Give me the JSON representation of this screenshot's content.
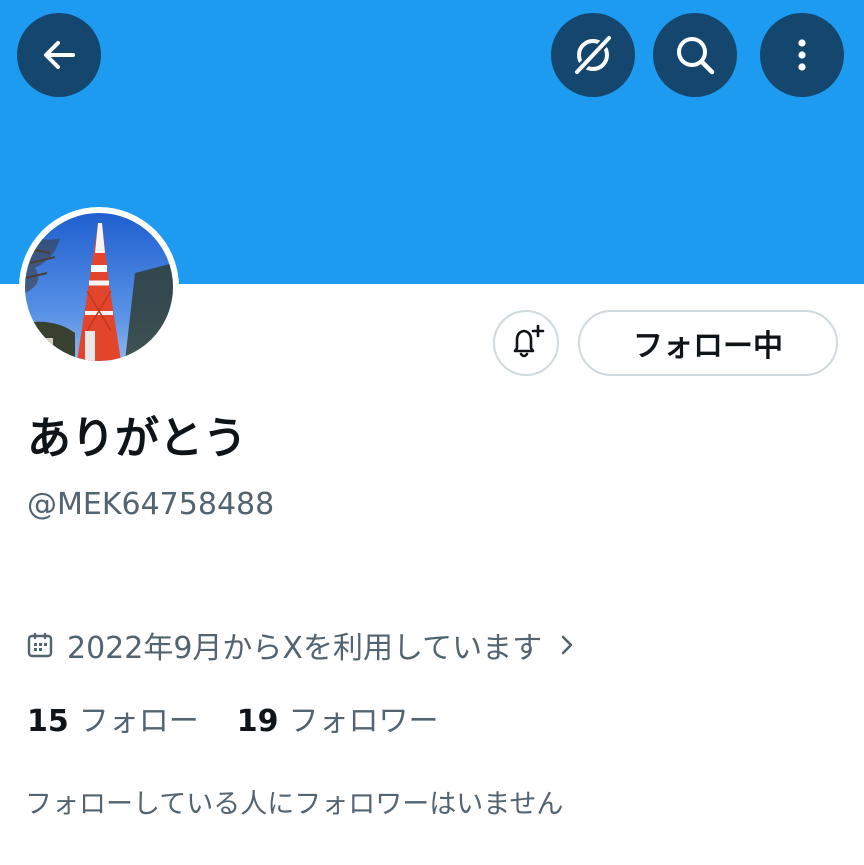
{
  "header": {
    "banner_color": "#1d9bf0",
    "back_icon": "arrow-left-icon",
    "grok_icon": "grok-slash-icon",
    "search_icon": "search-icon",
    "more_icon": "more-vertical-icon"
  },
  "profile": {
    "display_name": "ありがとう",
    "handle": "@MEK64758488",
    "avatar_description": "tokyo-tower-photo",
    "joined": "2022年9月からXを利用しています",
    "following_count": "15",
    "following_label": "フォロー",
    "followers_count": "19",
    "followers_label": "フォロワー",
    "mutual_note": "フォローしている人にフォロワーはいません"
  },
  "actions": {
    "follow_button_label": "フォロー中",
    "notify_icon": "bell-plus-icon"
  },
  "colors": {
    "accent": "#1d9bf0",
    "header_button": "#15466e",
    "muted_text": "#536471",
    "primary_text": "#0f1419"
  }
}
